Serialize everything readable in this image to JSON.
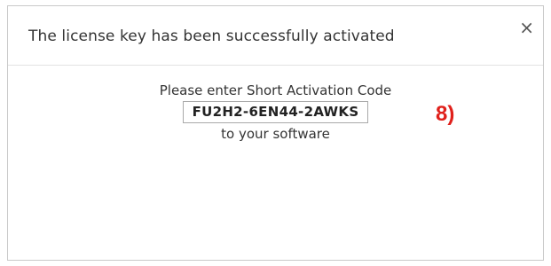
{
  "dialog": {
    "title": "The license key has been successfully activated",
    "close_label": "×",
    "close_icon": "close-icon"
  },
  "body": {
    "instruction": "Please enter Short Activation Code",
    "activation_code": "FU2H2-6EN44-2AWKS",
    "suffix": "to your software"
  },
  "annotation": {
    "step_label": "8)",
    "color": "#e0201b"
  }
}
